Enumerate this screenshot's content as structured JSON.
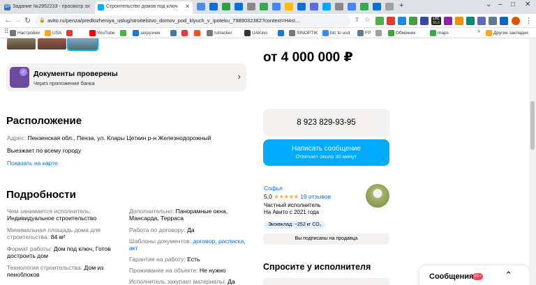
{
  "browser": {
    "tabs": [
      {
        "title": "Задание №2952233 - просмотр з",
        "favicon": "SP"
      },
      {
        "title": "Строительство домов под ключ",
        "favicon": ""
      }
    ],
    "url": "avito.ru/penza/predlozheniya_uslug/stroitelstvo_domov_pod_klyuch_v_ipoteku_7989032382?context=H4sI...",
    "ext_labels": {
      "ltc": "LTC",
      "ltc_val": "55.0"
    },
    "bookmarks": [
      "Настройки",
      "USA",
      "",
      "YouTube",
      "",
      "загрузчик",
      "",
      "",
      "",
      "rutracker",
      "UAKino",
      "",
      "SINOPTIK",
      "btc to usd",
      "FP",
      "",
      "Обмінник",
      "maps"
    ],
    "other_bookmarks": "Другие закладки"
  },
  "page": {
    "docs": {
      "title": "Документы проверены",
      "subtitle": "Через приложение банка"
    },
    "location": {
      "heading": "Расположение",
      "address_label": "Адрес: ",
      "address": "Пензенская обл., Пенза, ул. Клары Цеткин  р-н Железнодорожный",
      "travel": "Выезжает по всему городу",
      "map_link": "Показать на карте"
    },
    "details": {
      "heading": "Подробности",
      "left": [
        {
          "label": "Чем занимается исполнитель:",
          "value": "Индивидуальное строительство"
        },
        {
          "label": "Минимальная площадь дома для строительства:",
          "value": "84 м²"
        },
        {
          "label": "Формат работы:",
          "value": "Дом под ключ, Готов достроить дом"
        },
        {
          "label": "Технология строительства:",
          "value": "Дом из пеноблоков"
        }
      ],
      "right": [
        {
          "label": "Дополнительно:",
          "value": "Панорамные окна, Мансарда, Терраса"
        },
        {
          "label": "Работа по договору:",
          "value": "Да"
        },
        {
          "label": "Шаблоны документов:",
          "value": "договор, расписка, акт"
        },
        {
          "label": "Гарантия на работу:",
          "value": "Есть"
        },
        {
          "label": "Проживание на объекте:",
          "value": "Не нужно"
        },
        {
          "label": "Исполнитель закупает материалы:",
          "value": "Да"
        }
      ]
    },
    "price": "от 4 000 000 ₽",
    "phone": "8 923 829-93-95",
    "message_button": {
      "label": "Написать сообщение",
      "sub": "Отвечает около 30 минут"
    },
    "seller": {
      "name": "Софья",
      "rating": "5,0",
      "stars": "★★★★★",
      "reviews": "19 отзывов",
      "type": "Частный исполнитель",
      "since": "На Авито с 2021 года",
      "eco": "Экоквклад: ~252 кг CO₂"
    },
    "subscribed": "Вы подписаны на продавца",
    "ask_heading": "Спросите у исполнителя",
    "messages": {
      "label": "Сообщения",
      "badge": "99+"
    }
  }
}
